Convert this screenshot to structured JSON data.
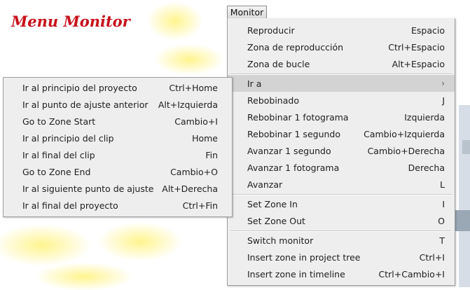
{
  "colors": {
    "title": "#c8101a",
    "menu_bg": "#eeeeee",
    "highlight": "#d3d3d3"
  },
  "page_title": "Menu Monitor",
  "menubar": {
    "label": "Monitor"
  },
  "main_menu": [
    {
      "label": "Reproducir",
      "shortcut": "Espacio"
    },
    {
      "label": "Zona de reproducción",
      "shortcut": "Ctrl+Espacio"
    },
    {
      "label": "Zona de bucle",
      "shortcut": "Alt+Espacio"
    },
    {
      "label": "Ir a",
      "shortcut": "›"
    },
    {
      "label": "Rebobinado",
      "shortcut": "J"
    },
    {
      "label": "Rebobinar 1 fotograma",
      "shortcut": "Izquierda"
    },
    {
      "label": "Rebobinar 1 segundo",
      "shortcut": "Cambio+Izquierda"
    },
    {
      "label": "Avanzar 1 segundo",
      "shortcut": "Cambio+Derecha"
    },
    {
      "label": "Avanzar 1 fotograma",
      "shortcut": "Derecha"
    },
    {
      "label": "Avanzar",
      "shortcut": "L"
    },
    {
      "label": "Set Zone In",
      "shortcut": "I"
    },
    {
      "label": "Set Zone Out",
      "shortcut": "O"
    },
    {
      "label": "Switch monitor",
      "shortcut": "T"
    },
    {
      "label": "Insert zone in project tree",
      "shortcut": "Ctrl+I"
    },
    {
      "label": "Insert zone in timeline",
      "shortcut": "Ctrl+Cambio+I"
    }
  ],
  "sub_menu": [
    {
      "label": "Ir al principio del proyecto",
      "shortcut": "Ctrl+Home"
    },
    {
      "label": "Ir al punto de ajuste anterior",
      "shortcut": "Alt+Izquierda"
    },
    {
      "label": "Go to Zone Start",
      "shortcut": "Cambio+I"
    },
    {
      "label": "Ir al principio del clip",
      "shortcut": "Home"
    },
    {
      "label": "Ir al final del clip",
      "shortcut": "Fin"
    },
    {
      "label": "Go to Zone End",
      "shortcut": "Cambio+O"
    },
    {
      "label": "Ir al siguiente punto de ajuste",
      "shortcut": "Alt+Derecha"
    },
    {
      "label": "Ir al final del proyecto",
      "shortcut": "Ctrl+Fin"
    }
  ]
}
